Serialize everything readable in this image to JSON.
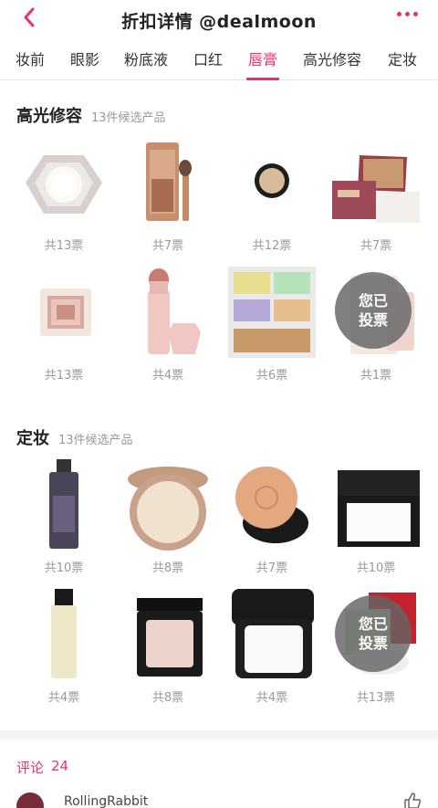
{
  "header": {
    "title": "折扣详情 @dealmoon"
  },
  "tabs": [
    "妆前",
    "眼影",
    "粉底液",
    "口红",
    "唇膏",
    "高光修容",
    "定妆"
  ],
  "active_tab": "唇膏",
  "sections": [
    {
      "title": "高光修容",
      "count": "13件候选产品",
      "items": [
        {
          "votes": "共13票",
          "icon": "highlighter-compact-icon"
        },
        {
          "votes": "共7票",
          "icon": "contour-palette-icon"
        },
        {
          "votes": "共12票",
          "icon": "mac-powder-icon"
        },
        {
          "votes": "共7票",
          "icon": "hoola-bronzer-icon"
        },
        {
          "votes": "共13票",
          "icon": "bobbi-highlight-icon"
        },
        {
          "votes": "共4票",
          "icon": "fenty-stick-icon"
        },
        {
          "votes": "共6票",
          "icon": "nyx-palette-icon"
        },
        {
          "votes": "共1票",
          "icon": "benefit-highbeam-icon",
          "voted": "您已投票"
        }
      ]
    },
    {
      "title": "定妆",
      "count": "13件候选产品",
      "items": [
        {
          "votes": "共10票",
          "icon": "setting-spray-icon"
        },
        {
          "votes": "共8票",
          "icon": "tilbury-powder-icon"
        },
        {
          "votes": "共7票",
          "icon": "armani-cushion-icon"
        },
        {
          "votes": "共10票",
          "icon": "nars-powder-icon"
        },
        {
          "votes": "共4票",
          "icon": "mac-fix-spray-icon"
        },
        {
          "votes": "共8票",
          "icon": "bobbi-compact-icon"
        },
        {
          "votes": "共4票",
          "icon": "mufe-compact-icon"
        },
        {
          "votes": "共13票",
          "icon": "givenchy-powder-icon",
          "voted": "您已投票"
        }
      ]
    }
  ],
  "comments": {
    "label": "评论",
    "count": "24"
  },
  "first_comment": {
    "user": "RollingRabbit"
  },
  "colors": {
    "accent": "#e8336d",
    "muted": "#999999"
  }
}
